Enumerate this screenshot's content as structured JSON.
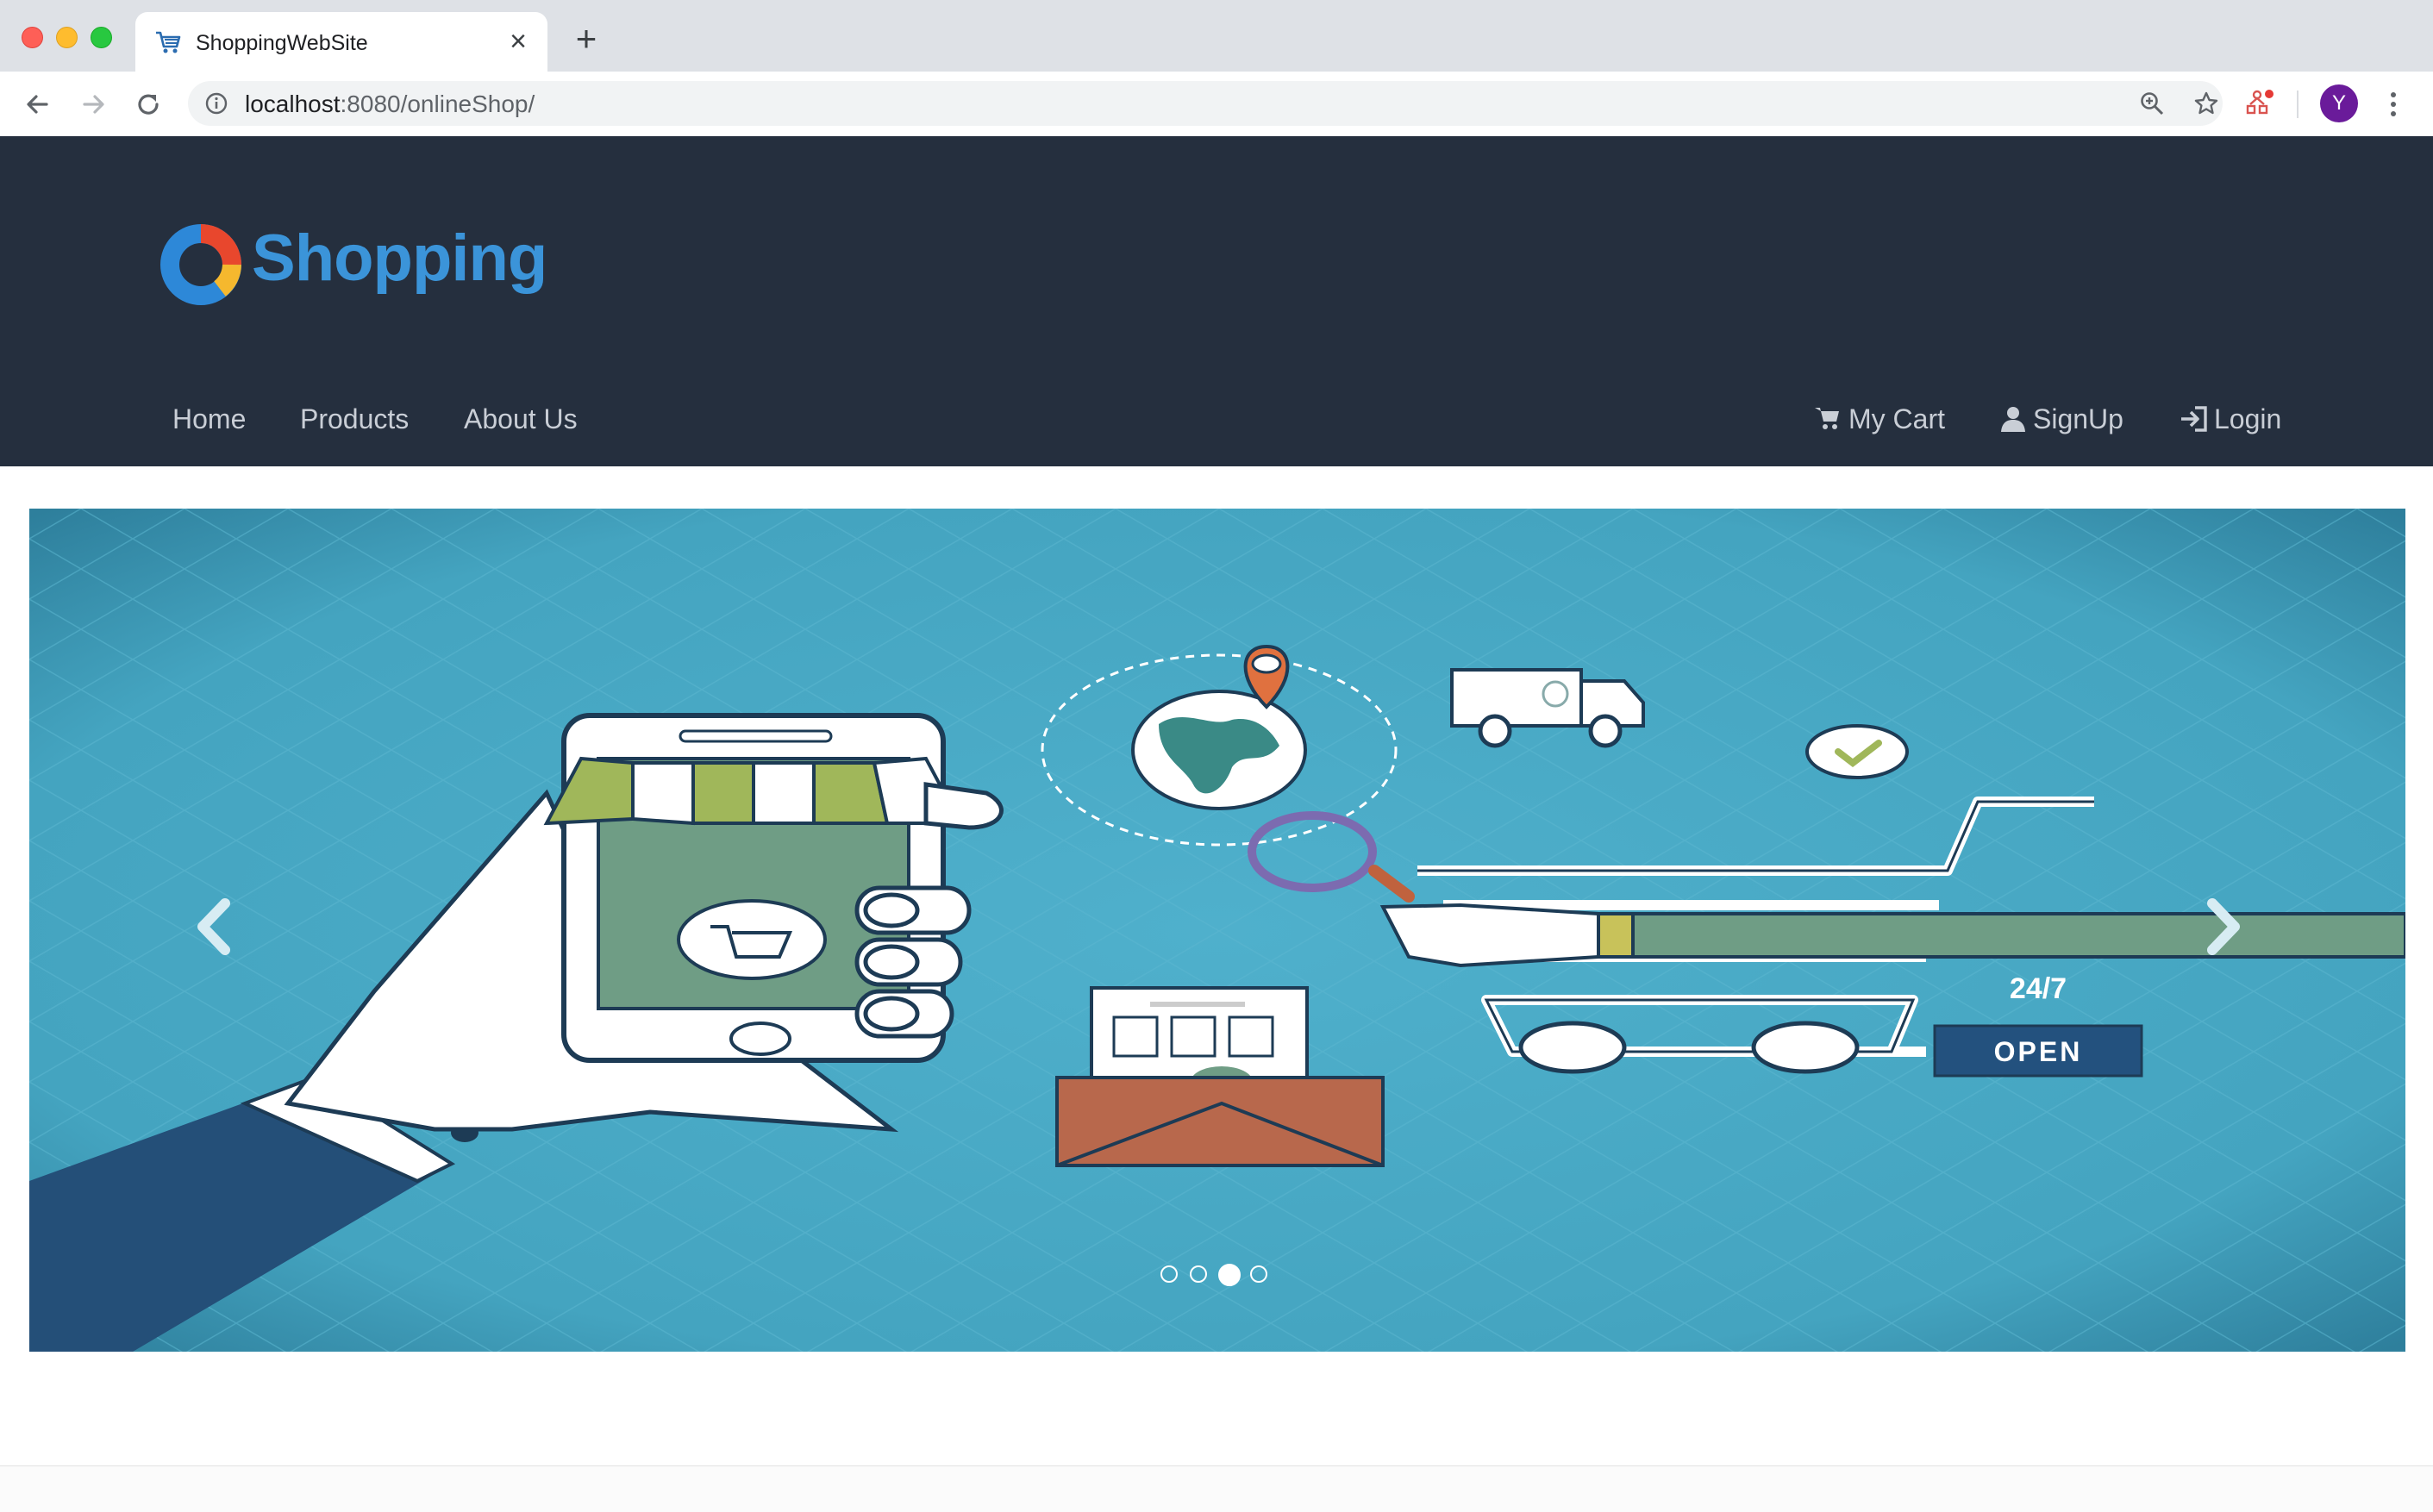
{
  "browser": {
    "tab_title": "ShoppingWebSite",
    "tab_favicon": "cart-icon",
    "close_icon": "close-icon",
    "new_tab_icon": "plus-icon",
    "url_host": "localhost",
    "url_path": ":8080/onlineShop/",
    "avatar_letter": "Y",
    "avatar_color": "#6a1b9a"
  },
  "header": {
    "logo_text": "Shopping",
    "logo_color": "#3b94d9",
    "background": "#252f3e",
    "nav": [
      {
        "label": "Home"
      },
      {
        "label": "Products"
      },
      {
        "label": "About Us"
      }
    ],
    "nav_right": [
      {
        "label": "My Cart",
        "icon": "cart-icon"
      },
      {
        "label": "SignUp",
        "icon": "user-icon"
      },
      {
        "label": "Login",
        "icon": "login-icon"
      }
    ]
  },
  "carousel": {
    "slide_count": 4,
    "active_slide_index": 2,
    "prev_icon": "chevron-left-icon",
    "next_icon": "chevron-right-icon",
    "banner": {
      "hours_text": "24/7",
      "sign_text": "OPEN"
    }
  }
}
